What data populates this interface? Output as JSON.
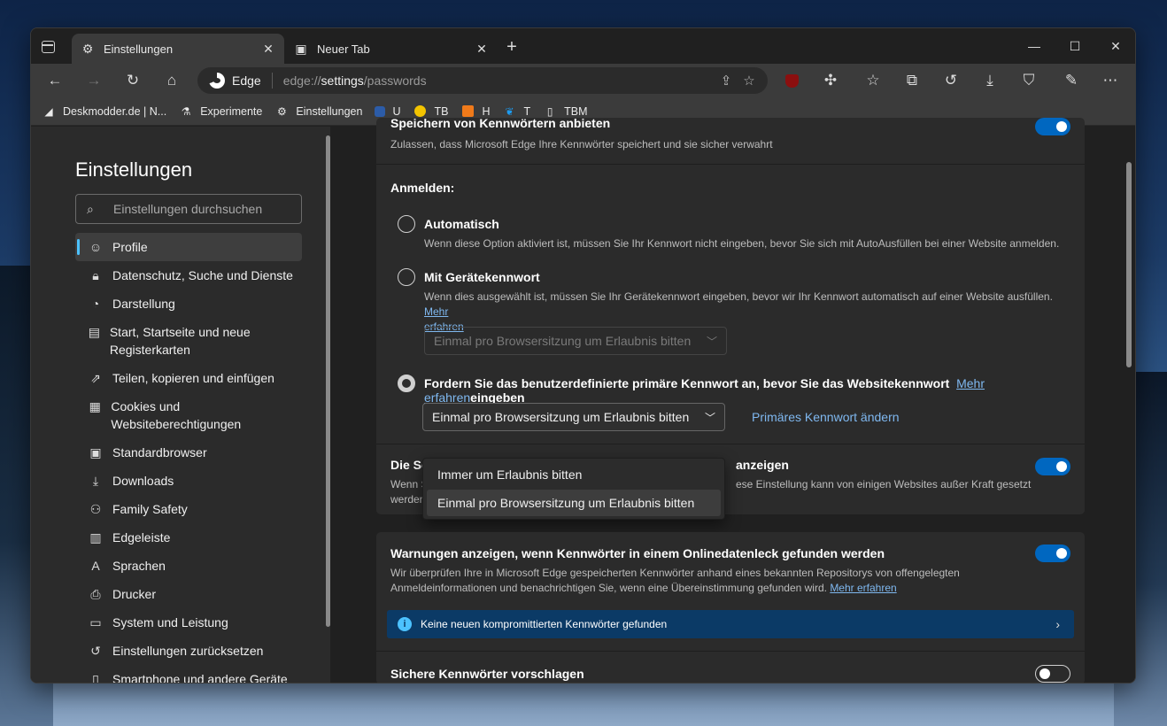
{
  "tabs": [
    {
      "label": "Einstellungen",
      "icon": "gear-icon"
    },
    {
      "label": "Neuer Tab",
      "icon": "newtab-icon"
    }
  ],
  "toolbar": {
    "brand": "Edge",
    "url_prefix": "edge://",
    "url_bold": "settings",
    "url_suffix": "/passwords"
  },
  "favorites": [
    {
      "label": "Deskmodder.de | N...",
      "icon": "deskmodder-icon"
    },
    {
      "label": "Experimente",
      "icon": "flask-icon"
    },
    {
      "label": "Einstellungen",
      "icon": "gear-icon"
    },
    {
      "label": "U",
      "icon": "u-icon"
    },
    {
      "label": "TB",
      "icon": "tb-icon"
    },
    {
      "label": "H",
      "icon": "h-icon"
    },
    {
      "label": "T",
      "icon": "twitter-icon"
    },
    {
      "label": "TBM",
      "icon": "page-icon"
    }
  ],
  "sidebar": {
    "title": "Einstellungen",
    "search_placeholder": "Einstellungen durchsuchen",
    "items": [
      {
        "label": "Profile",
        "icon": "profile-icon"
      },
      {
        "label": "Datenschutz, Suche und Dienste",
        "icon": "lock-icon"
      },
      {
        "label": "Darstellung",
        "icon": "palette-icon"
      },
      {
        "label": "Start, Startseite und neue Registerkarten",
        "icon": "home-icon"
      },
      {
        "label": "Teilen, kopieren und einfügen",
        "icon": "share-icon"
      },
      {
        "label": "Cookies und Websiteberechtigungen",
        "icon": "cookie-icon"
      },
      {
        "label": "Standardbrowser",
        "icon": "browser-icon"
      },
      {
        "label": "Downloads",
        "icon": "download-icon"
      },
      {
        "label": "Family Safety",
        "icon": "family-icon"
      },
      {
        "label": "Edgeleiste",
        "icon": "sidebar-icon"
      },
      {
        "label": "Sprachen",
        "icon": "language-icon"
      },
      {
        "label": "Drucker",
        "icon": "printer-icon"
      },
      {
        "label": "System und Leistung",
        "icon": "system-icon"
      },
      {
        "label": "Einstellungen zurücksetzen",
        "icon": "reset-icon"
      },
      {
        "label": "Smartphone und andere Geräte",
        "icon": "phone-icon"
      }
    ]
  },
  "main": {
    "top_title": "Speichern von Kennwörtern anbieten",
    "top_desc": "Zulassen, dass Microsoft Edge Ihre Kennwörter speichert und sie sicher verwahrt",
    "signin_label": "Anmelden:",
    "option_auto_title": "Automatisch",
    "option_auto_desc": "Wenn diese Option aktiviert ist, müssen Sie Ihr Kennwort nicht eingeben, bevor Sie sich mit AutoAusfüllen bei einer Website anmelden.",
    "option_device_title": "Mit Gerätekennwort",
    "option_device_desc": "Wenn dies ausgewählt ist, müssen Sie Ihr Gerätekennwort eingeben, bevor wir Ihr Kennwort automatisch auf einer Website ausfüllen.",
    "option_device_link_a": "Mehr",
    "option_device_link_b": "erfahren",
    "option_device_select": "Einmal pro Browsersitzung um Erlaubnis bitten",
    "option_custom_title_a": "Fordern Sie das benutzerdefinierte primäre Kennwort an, bevor Sie das Websitekennwort",
    "option_custom_link": "Mehr erfahren",
    "option_custom_title_b": "eingeben",
    "option_custom_select": "Einmal pro Browsersitzung um Erlaubnis bitten",
    "change_primary_link": "Primäres Kennwort ändern",
    "dropdown_options": [
      "Immer um Erlaubnis bitten",
      "Einmal pro Browsersitzung um Erlaubnis bitten"
    ],
    "show_button_title_a": "Die Sc",
    "show_button_title_b": "anzeigen",
    "show_button_desc_a": "Wenn S",
    "show_button_desc_b": "ese Einstellung kann von einigen Websites außer Kraft gesetzt",
    "show_button_desc_c": "werden",
    "leak_title": "Warnungen anzeigen, wenn Kennwörter in einem Onlinedatenleck gefunden werden",
    "leak_desc_1": "Wir überprüfen Ihre in Microsoft Edge gespeicherten Kennwörter anhand eines bekannten Repositorys von offengelegten",
    "leak_desc_2": "Anmeldeinformationen und benachrichtigen Sie, wenn eine Übereinstimmung gefunden wird.",
    "leak_link": "Mehr erfahren",
    "info_text": "Keine neuen kompromittierten Kennwörter gefunden",
    "suggest_title": "Sichere Kennwörter vorschlagen"
  },
  "colors": {
    "accent": "#0067c0",
    "link": "#7fb8f0",
    "info_bg": "#0b3a66"
  }
}
